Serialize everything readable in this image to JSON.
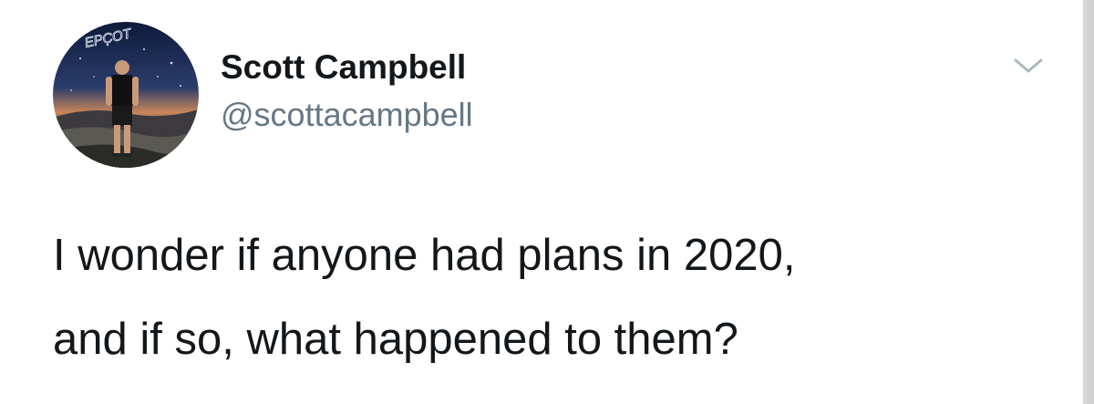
{
  "tweet": {
    "author": {
      "display_name": "Scott Campbell",
      "handle": "@scottacampbell",
      "avatar_sign_text": "EPCOT"
    },
    "text_lines": [
      "I wonder if anyone had plans in 2020,",
      "and if so, what happened to them?"
    ],
    "menu_icon": "chevron-down-icon"
  },
  "colors": {
    "name": "#14171a",
    "handle": "#657786",
    "body_text": "#14171a",
    "chevron": "#aab8c2",
    "background": "#ffffff"
  }
}
